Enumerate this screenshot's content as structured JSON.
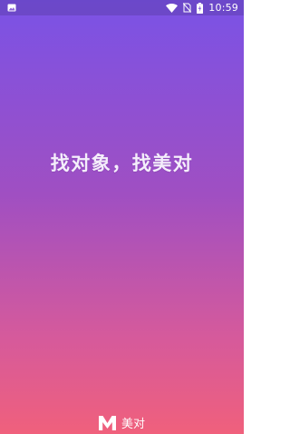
{
  "status_bar": {
    "time": "10:59",
    "icons": [
      "gallery-notification-icon",
      "wifi-icon",
      "no-sim-icon",
      "battery-charging-icon"
    ]
  },
  "splash": {
    "slogan": "找对象，找美对"
  },
  "brand": {
    "logo_letter": "M",
    "name": "美对"
  },
  "colors": {
    "gradient_top": "#7a52e6",
    "gradient_mid": "#a04fc2",
    "gradient_bottom": "#f0607c",
    "text": "#ffffff"
  }
}
